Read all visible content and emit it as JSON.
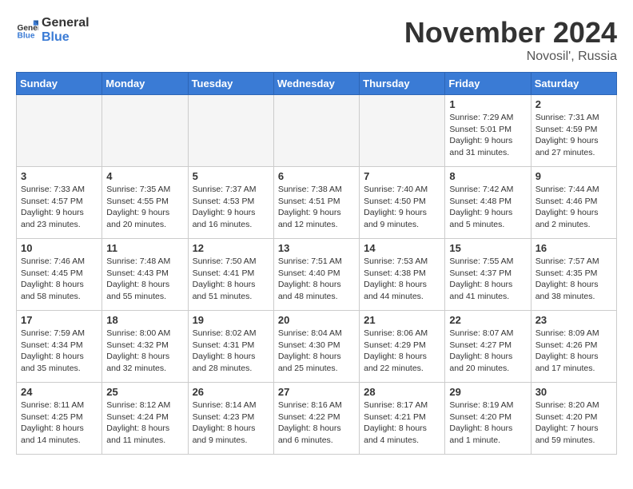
{
  "header": {
    "logo_general": "General",
    "logo_blue": "Blue",
    "month_title": "November 2024",
    "location": "Novosil', Russia"
  },
  "weekdays": [
    "Sunday",
    "Monday",
    "Tuesday",
    "Wednesday",
    "Thursday",
    "Friday",
    "Saturday"
  ],
  "weeks": [
    [
      {
        "day": "",
        "info": ""
      },
      {
        "day": "",
        "info": ""
      },
      {
        "day": "",
        "info": ""
      },
      {
        "day": "",
        "info": ""
      },
      {
        "day": "",
        "info": ""
      },
      {
        "day": "1",
        "info": "Sunrise: 7:29 AM\nSunset: 5:01 PM\nDaylight: 9 hours and 31 minutes."
      },
      {
        "day": "2",
        "info": "Sunrise: 7:31 AM\nSunset: 4:59 PM\nDaylight: 9 hours and 27 minutes."
      }
    ],
    [
      {
        "day": "3",
        "info": "Sunrise: 7:33 AM\nSunset: 4:57 PM\nDaylight: 9 hours and 23 minutes."
      },
      {
        "day": "4",
        "info": "Sunrise: 7:35 AM\nSunset: 4:55 PM\nDaylight: 9 hours and 20 minutes."
      },
      {
        "day": "5",
        "info": "Sunrise: 7:37 AM\nSunset: 4:53 PM\nDaylight: 9 hours and 16 minutes."
      },
      {
        "day": "6",
        "info": "Sunrise: 7:38 AM\nSunset: 4:51 PM\nDaylight: 9 hours and 12 minutes."
      },
      {
        "day": "7",
        "info": "Sunrise: 7:40 AM\nSunset: 4:50 PM\nDaylight: 9 hours and 9 minutes."
      },
      {
        "day": "8",
        "info": "Sunrise: 7:42 AM\nSunset: 4:48 PM\nDaylight: 9 hours and 5 minutes."
      },
      {
        "day": "9",
        "info": "Sunrise: 7:44 AM\nSunset: 4:46 PM\nDaylight: 9 hours and 2 minutes."
      }
    ],
    [
      {
        "day": "10",
        "info": "Sunrise: 7:46 AM\nSunset: 4:45 PM\nDaylight: 8 hours and 58 minutes."
      },
      {
        "day": "11",
        "info": "Sunrise: 7:48 AM\nSunset: 4:43 PM\nDaylight: 8 hours and 55 minutes."
      },
      {
        "day": "12",
        "info": "Sunrise: 7:50 AM\nSunset: 4:41 PM\nDaylight: 8 hours and 51 minutes."
      },
      {
        "day": "13",
        "info": "Sunrise: 7:51 AM\nSunset: 4:40 PM\nDaylight: 8 hours and 48 minutes."
      },
      {
        "day": "14",
        "info": "Sunrise: 7:53 AM\nSunset: 4:38 PM\nDaylight: 8 hours and 44 minutes."
      },
      {
        "day": "15",
        "info": "Sunrise: 7:55 AM\nSunset: 4:37 PM\nDaylight: 8 hours and 41 minutes."
      },
      {
        "day": "16",
        "info": "Sunrise: 7:57 AM\nSunset: 4:35 PM\nDaylight: 8 hours and 38 minutes."
      }
    ],
    [
      {
        "day": "17",
        "info": "Sunrise: 7:59 AM\nSunset: 4:34 PM\nDaylight: 8 hours and 35 minutes."
      },
      {
        "day": "18",
        "info": "Sunrise: 8:00 AM\nSunset: 4:32 PM\nDaylight: 8 hours and 32 minutes."
      },
      {
        "day": "19",
        "info": "Sunrise: 8:02 AM\nSunset: 4:31 PM\nDaylight: 8 hours and 28 minutes."
      },
      {
        "day": "20",
        "info": "Sunrise: 8:04 AM\nSunset: 4:30 PM\nDaylight: 8 hours and 25 minutes."
      },
      {
        "day": "21",
        "info": "Sunrise: 8:06 AM\nSunset: 4:29 PM\nDaylight: 8 hours and 22 minutes."
      },
      {
        "day": "22",
        "info": "Sunrise: 8:07 AM\nSunset: 4:27 PM\nDaylight: 8 hours and 20 minutes."
      },
      {
        "day": "23",
        "info": "Sunrise: 8:09 AM\nSunset: 4:26 PM\nDaylight: 8 hours and 17 minutes."
      }
    ],
    [
      {
        "day": "24",
        "info": "Sunrise: 8:11 AM\nSunset: 4:25 PM\nDaylight: 8 hours and 14 minutes."
      },
      {
        "day": "25",
        "info": "Sunrise: 8:12 AM\nSunset: 4:24 PM\nDaylight: 8 hours and 11 minutes."
      },
      {
        "day": "26",
        "info": "Sunrise: 8:14 AM\nSunset: 4:23 PM\nDaylight: 8 hours and 9 minutes."
      },
      {
        "day": "27",
        "info": "Sunrise: 8:16 AM\nSunset: 4:22 PM\nDaylight: 8 hours and 6 minutes."
      },
      {
        "day": "28",
        "info": "Sunrise: 8:17 AM\nSunset: 4:21 PM\nDaylight: 8 hours and 4 minutes."
      },
      {
        "day": "29",
        "info": "Sunrise: 8:19 AM\nSunset: 4:20 PM\nDaylight: 8 hours and 1 minute."
      },
      {
        "day": "30",
        "info": "Sunrise: 8:20 AM\nSunset: 4:20 PM\nDaylight: 7 hours and 59 minutes."
      }
    ]
  ]
}
